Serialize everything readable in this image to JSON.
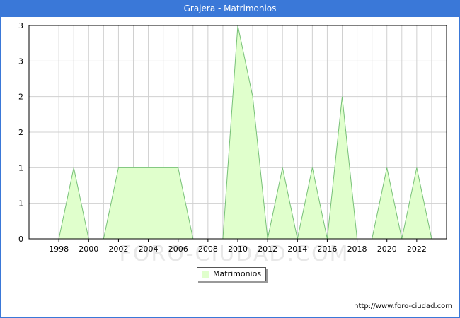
{
  "header": {
    "title": "Grajera - Matrimonios"
  },
  "footer": {
    "source": "http://www.foro-ciudad.com"
  },
  "watermark": "FORO-CIUDAD.COM",
  "colors": {
    "titlebar": "#3a78d8",
    "area_fill": "#e0ffcc",
    "area_line": "#77c077",
    "grid": "#d0d0d0"
  },
  "chart_data": {
    "type": "area",
    "title": "Grajera - Matrimonios",
    "xlabel": "",
    "ylabel": "",
    "grid": true,
    "legend_position": "bottom-center",
    "x": [
      1997,
      1998,
      1999,
      2000,
      2001,
      2002,
      2003,
      2004,
      2005,
      2006,
      2007,
      2008,
      2009,
      2010,
      2011,
      2012,
      2013,
      2014,
      2015,
      2016,
      2017,
      2018,
      2019,
      2020,
      2021,
      2022,
      2023
    ],
    "x_tick_labels": [
      "1998",
      "2000",
      "2002",
      "2004",
      "2006",
      "2008",
      "2010",
      "2012",
      "2014",
      "2016",
      "2018",
      "2020",
      "2022"
    ],
    "y_tick_labels": [
      "0",
      "1",
      "1",
      "2",
      "2",
      "3",
      "3"
    ],
    "ylim": [
      0,
      3
    ],
    "series": [
      {
        "name": "Matrimonios",
        "values": [
          0,
          0,
          1,
          0,
          0,
          1,
          1,
          1,
          1,
          1,
          0,
          0,
          0,
          3,
          2,
          0,
          1,
          0,
          1,
          0,
          2,
          0,
          0,
          1,
          0,
          1,
          0
        ]
      }
    ]
  }
}
